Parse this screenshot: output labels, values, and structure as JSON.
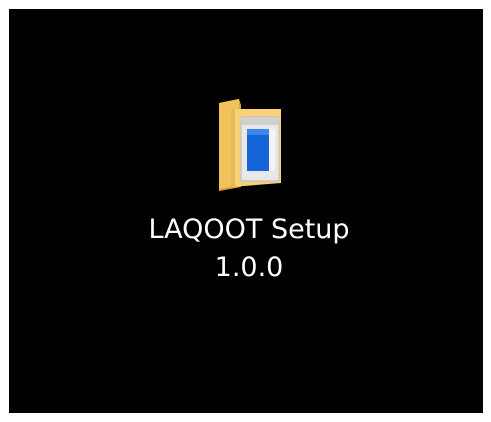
{
  "desktop": {
    "background_color": "#000000",
    "icons": [
      {
        "icon": "folder-installer-icon",
        "label_line1": "LAQOOT Setup",
        "label_line2": "1.0.0"
      }
    ]
  }
}
